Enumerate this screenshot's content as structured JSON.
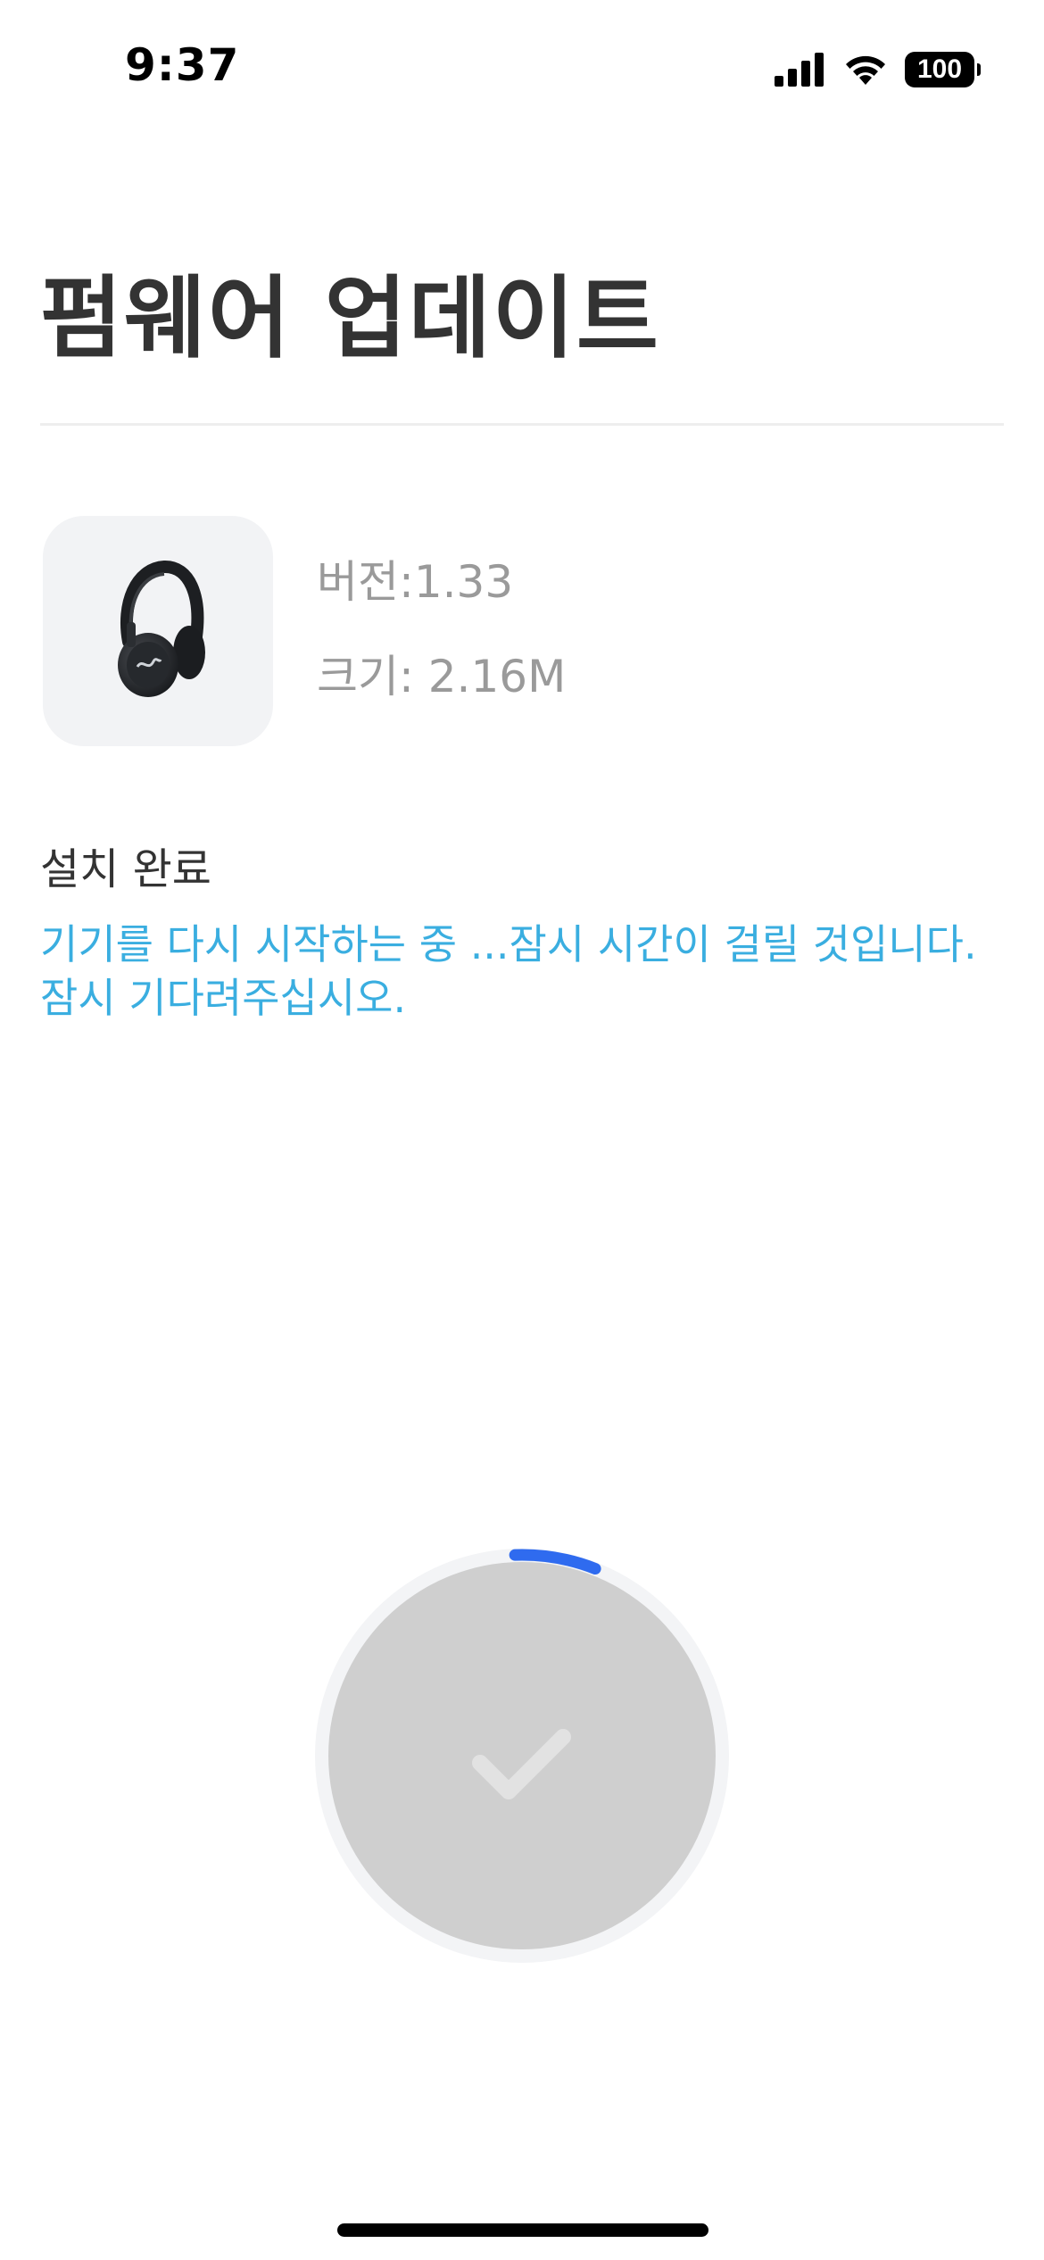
{
  "status_bar": {
    "time": "9:37",
    "battery_level": "100",
    "icons": [
      "cellular-signal-icon",
      "wifi-icon",
      "battery-icon"
    ]
  },
  "page": {
    "title": "펌웨어 업데이트"
  },
  "device": {
    "image": "headphones-image",
    "version": "버전:1.33",
    "size": "크기: 2.16M"
  },
  "install": {
    "status": "설치 완료",
    "message": "기기를 다시 시작하는 중 ...잠시 시간이 걸릴 것입니다. 잠시 기다려주십시오."
  },
  "progress": {
    "icon": "checkmark-icon",
    "arc_fraction": 0.065
  },
  "colors": {
    "title": "#333333",
    "info_text": "#9a9a9a",
    "message": "#3aaee0",
    "progress_accent": "#2f6bef",
    "circle_fill": "#cfcfcf",
    "ring_track": "#f3f4f6"
  }
}
